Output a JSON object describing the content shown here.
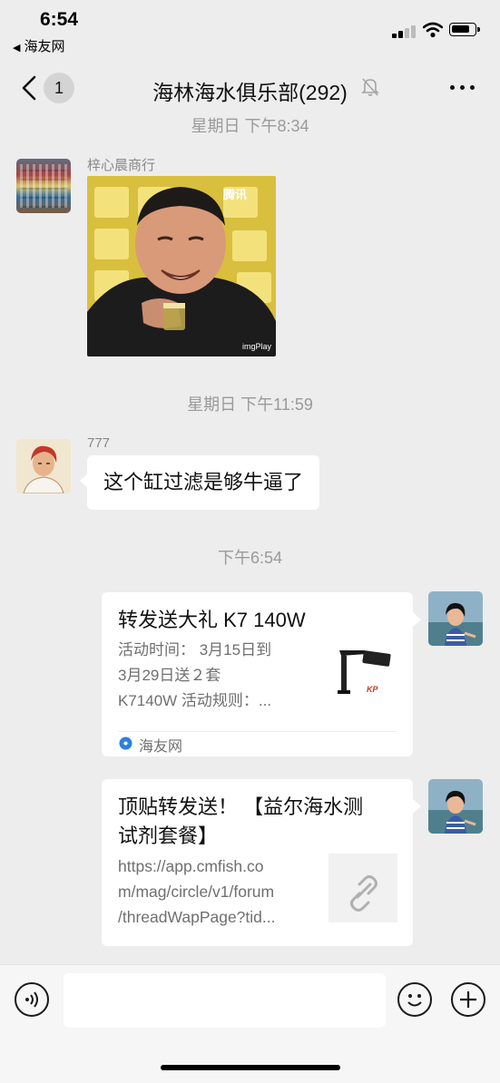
{
  "status_bar": {
    "time": "6:54",
    "back_app": "海友网"
  },
  "nav": {
    "back_count": "1",
    "title": "海林海水俱乐部(292)"
  },
  "messages": {
    "ts1": "星期日 下午8:34",
    "msg1": {
      "sender": "梓心晨商行",
      "gif_watermark_top": "腾讯",
      "gif_watermark_bottom": "imgPlay"
    },
    "ts2": "星期日 下午11:59",
    "msg2": {
      "sender": "777",
      "text": "这个缸过滤是够牛逼了"
    },
    "ts3": "下午6:54",
    "card1": {
      "title": "转发送大礼  K7 140W",
      "desc_line1": "活动时间：  3月15日到",
      "desc_line2": "3月29日送２套",
      "desc_line3": "K7140W 活动规则：...",
      "source": "海友网",
      "thumb_brand": "KP"
    },
    "card2": {
      "title_line1": "顶贴转发送！ 【益尔海水测",
      "title_line2": "试剂套餐】",
      "url_line1": "https://app.cmfish.co",
      "url_line2": "m/mag/circle/v1/forum",
      "url_line3": "/threadWapPage?tid..."
    }
  },
  "colors": {
    "background": "#ededed",
    "bubble": "#ffffff",
    "timestamp": "#9a9a9a",
    "accent_blue": "#2d7fe0"
  }
}
